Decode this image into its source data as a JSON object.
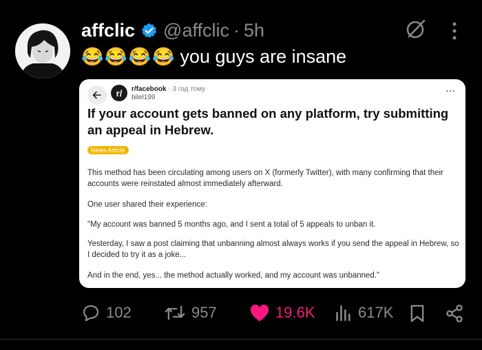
{
  "tweet": {
    "display_name": "affclic",
    "handle": "@affclic",
    "separator": "·",
    "time": "5h",
    "emojis": [
      "😂",
      "😂",
      "😂",
      "😂"
    ],
    "text": "you guys are insane"
  },
  "embedded_post": {
    "subreddit": "r/facebook",
    "time": "· 3 год тому",
    "username": "bilel199",
    "more": "···",
    "title": "If your account gets banned on any platform, try submitting an appeal in Hebrew.",
    "flair": "News Article",
    "paragraphs": [
      "This method has been circulating among users on X (formerly Twitter), with many confirming that their accounts were reinstated almost immediately afterward.",
      "One user shared their experience:",
      "\"My account was banned 5 months ago, and I sent a total of 5 appeals to unban it.",
      "Yesterday, I saw a post claiming that unbanning almost always works if you send the appeal in Hebrew, so I decided to try it as a joke...",
      "And in the end, yes... the method actually worked, and my account was unbanned.\""
    ]
  },
  "actions": {
    "replies": "102",
    "reposts": "957",
    "likes": "19.6K",
    "views": "617K"
  },
  "colors": {
    "background": "#000000",
    "like": "#f91880",
    "verified": "#1d9bf0",
    "muted": "#8b8b8b",
    "flair": "#f1b600"
  },
  "icons": [
    "verified-badge-icon",
    "grok-icon",
    "more-vertical-icon",
    "back-arrow-icon",
    "reply-icon",
    "repost-icon",
    "heart-icon",
    "views-icon",
    "bookmark-icon",
    "share-icon"
  ]
}
